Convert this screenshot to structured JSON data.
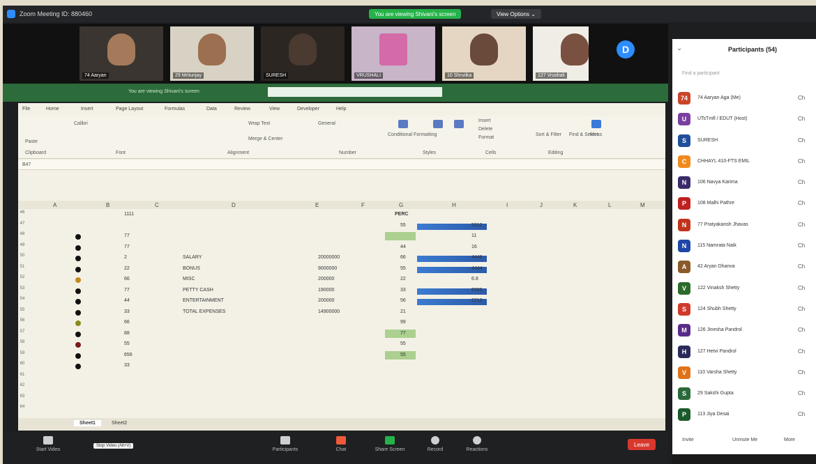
{
  "window": {
    "title": "Zoom Meeting ID: 880460",
    "share_notice": "You are viewing Shivani's screen",
    "view_options": "View Options ⌄"
  },
  "videos": [
    {
      "name": "74 Aaryan"
    },
    {
      "name": "29 Mritunjay"
    },
    {
      "name": "SURESH"
    },
    {
      "name": "VRUSHALI"
    },
    {
      "name": "10 Shrutika"
    },
    {
      "name": "127 Vrushali"
    },
    {
      "name": "",
      "avatar": "D"
    }
  ],
  "excel": {
    "tabs": [
      "File",
      "Home",
      "Insert",
      "Page Layout",
      "Formulas",
      "Data",
      "Review",
      "View",
      "Developer",
      "Help"
    ],
    "ribbon_labels": [
      "Paste",
      "Calibri",
      "Wrap Text",
      "General",
      "Conditional Formatting",
      "Format as Table",
      "Cell Styles",
      "Insert",
      "Delete",
      "Format",
      "Sort & Filter",
      "Find & Select",
      "Ideas",
      "Merge & Center",
      "Editing",
      "Cells",
      "Styles",
      "Number",
      "Alignment",
      "Font",
      "Clipboard"
    ],
    "name_box": "B47",
    "columns": [
      "A",
      "B",
      "C",
      "D",
      "E",
      "F",
      "G",
      "H",
      "I",
      "J",
      "K",
      "L",
      "M"
    ],
    "row_numbers": [
      "46",
      "47",
      "48",
      "49",
      "50",
      "51",
      "52",
      "53",
      "54",
      "55",
      "56",
      "57",
      "58",
      "59",
      "60",
      "61",
      "62",
      "63",
      "64"
    ],
    "top_value": "1111",
    "perc_header": "PERC",
    "col_b": [
      "77",
      "77",
      "2",
      "22",
      "66",
      "77",
      "44",
      "33",
      "66",
      "88",
      "55",
      "656",
      "33"
    ],
    "labels": [
      "SALARY",
      "BONUS",
      "MISC",
      "PETTY CASH",
      "ENTERTAINMENT",
      "TOTAL EXPENSES"
    ],
    "amounts": [
      "20000000",
      "9000000",
      "200000",
      "190000",
      "200000",
      "14900000"
    ],
    "col_g": [
      "55",
      "",
      "44",
      "66",
      "55",
      "22",
      "33",
      "56",
      "21",
      "99",
      "77",
      "55",
      "55"
    ],
    "col_h": [
      "5212",
      "11",
      "16",
      "4446",
      "4444",
      "6.8",
      "5555",
      "2212"
    ],
    "sheets": [
      "Sheet1",
      "Sheet2"
    ]
  },
  "controls": {
    "buttons": [
      "Start Video",
      "Participants",
      "Chat",
      "Share Screen",
      "Record",
      "Reactions"
    ],
    "tooltip": "Stop Video (Alt+V)",
    "leave": "Leave"
  },
  "participants": {
    "title": "Participants (54)",
    "search_placeholder": "Find a participant",
    "items": [
      {
        "initials": "74",
        "name": "74 Aaryan Aga (Me)",
        "color": "#c9452a"
      },
      {
        "initials": "U",
        "name": "UTsTmfl / EDUT (Host)",
        "color": "#7a3fa0"
      },
      {
        "initials": "S",
        "name": "SURESH",
        "color": "#1f4f9a"
      },
      {
        "initials": "C",
        "name": "CHHAYL 410-FTS EMIL",
        "color": "#f08a1e"
      },
      {
        "initials": "N",
        "name": "106 Navya Karima",
        "color": "#3a2a6a"
      },
      {
        "initials": "P",
        "name": "108 Malhi Pathre",
        "color": "#c02020"
      },
      {
        "initials": "N",
        "name": "77 Pratyakansh Jhavas",
        "color": "#c0341c"
      },
      {
        "initials": "N",
        "name": "115 Namrata Naik",
        "color": "#1f46a8"
      },
      {
        "initials": "A",
        "name": "42 Aryan Dhanva",
        "color": "#8a5a2a"
      },
      {
        "initials": "V",
        "name": "122 Vinaksh Shetty",
        "color": "#2a6a2a"
      },
      {
        "initials": "S",
        "name": "124 Shubh Shetty",
        "color": "#d03a2a"
      },
      {
        "initials": "M",
        "name": "126 Jinesha Pandrol",
        "color": "#5a2a8a"
      },
      {
        "initials": "H",
        "name": "127 Hetvi Pandrol",
        "color": "#2a2a5a"
      },
      {
        "initials": "V",
        "name": "110 Varsha Shetty",
        "color": "#e0721a"
      },
      {
        "initials": "S",
        "name": "29 Sakshi Gupta",
        "color": "#2a6a3a"
      },
      {
        "initials": "P",
        "name": "113 Jiya Desai",
        "color": "#1a5a2a"
      }
    ],
    "footer": [
      "Invite",
      "Unmute Me",
      "More"
    ],
    "status_label": "Ch"
  }
}
